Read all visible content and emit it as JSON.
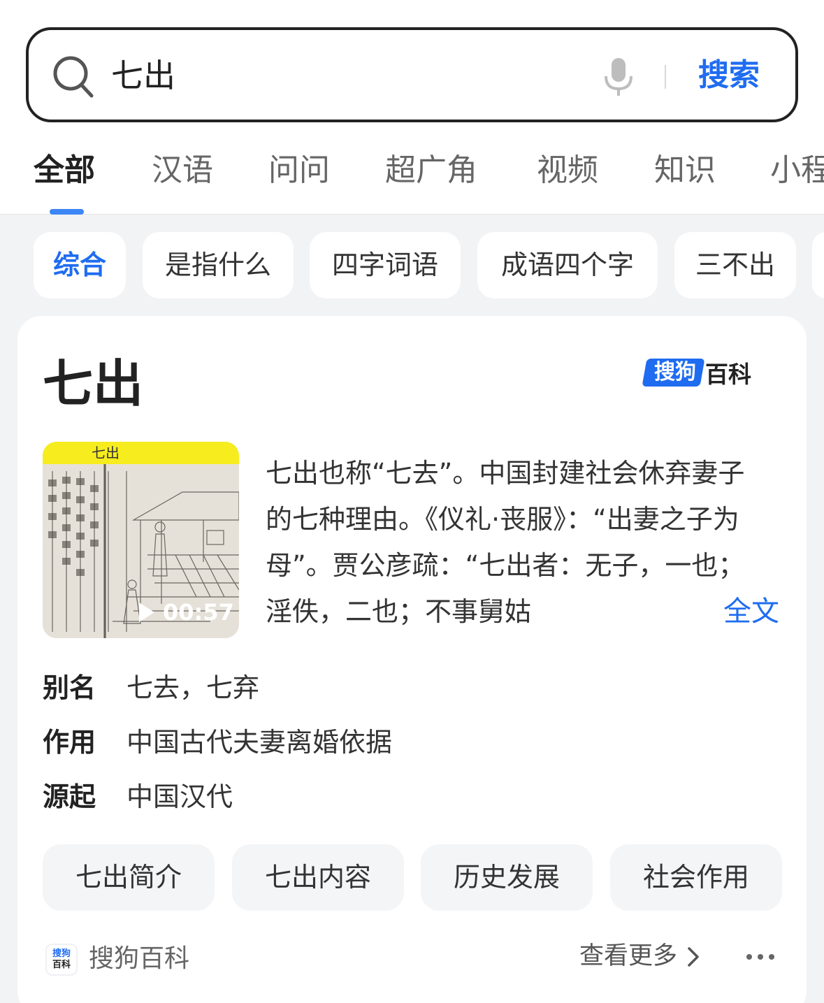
{
  "search": {
    "query": "七出",
    "button_label": "搜索"
  },
  "tabs": [
    {
      "label": "全部"
    },
    {
      "label": "汉语"
    },
    {
      "label": "问问"
    },
    {
      "label": "超广角"
    },
    {
      "label": "视频"
    },
    {
      "label": "知识"
    },
    {
      "label": "小程"
    }
  ],
  "chips": [
    {
      "label": "综合"
    },
    {
      "label": "是指什么"
    },
    {
      "label": "四字词语"
    },
    {
      "label": "成语四个字"
    },
    {
      "label": "三不出"
    }
  ],
  "card": {
    "title": "七出",
    "brand_badge": "搜狗",
    "brand_rest": "百科",
    "thumbnail_caption": "七出",
    "video_duration": "00:57",
    "description": "七出也称“七去”。中国封建社会休弃妻子的七种理由。《仪礼·丧服》：“出妻之子为母”。贾公彦疏：“七出者：无子，一也；淫佚，二也；不事舅姑",
    "fulltext_label": "全文",
    "attributes": [
      {
        "key": "别名",
        "value": "七去，七弃"
      },
      {
        "key": "作用",
        "value": "中国古代夫妻离婚依据"
      },
      {
        "key": "源起",
        "value": "中国汉代"
      }
    ],
    "sections": [
      {
        "label": "七出简介"
      },
      {
        "label": "七出内容"
      },
      {
        "label": "历史发展"
      },
      {
        "label": "社会作用"
      }
    ],
    "footer": {
      "logo_line1": "搜狗",
      "logo_line2": "百科",
      "source": "搜狗百科",
      "more_label": "查看更多"
    }
  },
  "colors": {
    "accent": "#1f6cf0",
    "tab_indicator": "#3d86f5",
    "page_bg": "#f2f3f5",
    "thumb_header": "#f7ec1e"
  },
  "icons": {
    "search": "search-icon",
    "mic": "microphone-icon",
    "play": "play-icon",
    "chevron": "chevron-right-icon",
    "menu": "more-dots-icon"
  }
}
